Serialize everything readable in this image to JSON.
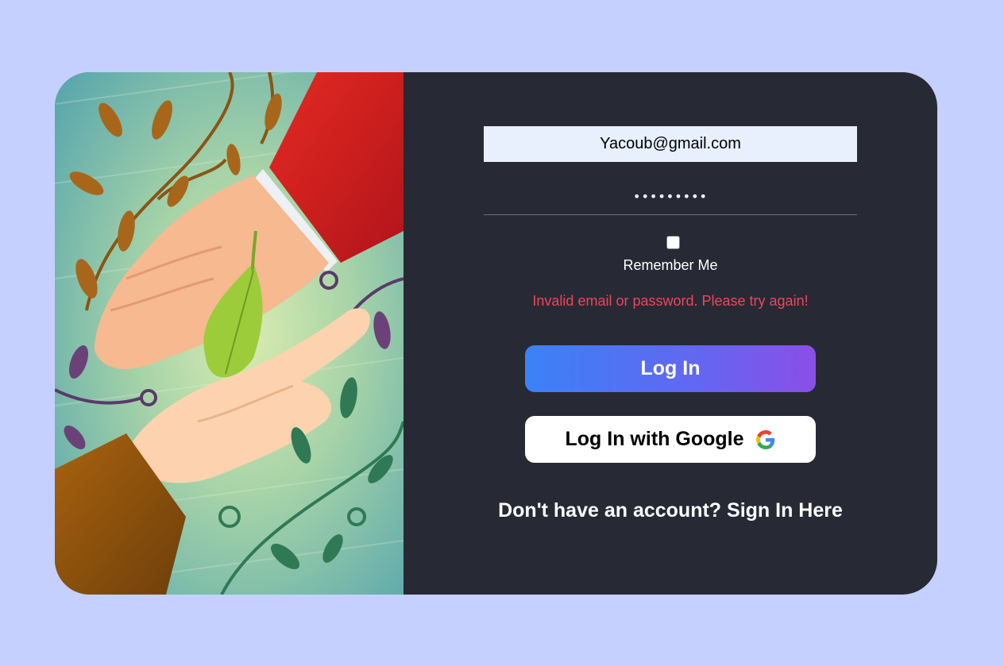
{
  "login": {
    "email_value": "Yacoub@gmail.com",
    "password_value": "•••••••••",
    "remember_label": "Remember Me",
    "remember_checked": false,
    "error_message": "Invalid email or password. Please try again!",
    "login_button": "Log In",
    "google_button": "Log In with Google",
    "signup_prompt": "Don't have an account?",
    "signup_link": "Sign In Here"
  },
  "colors": {
    "page_background": "#c5d0fe",
    "card_background": "#272a34",
    "error_text": "#f0445c",
    "login_gradient_start": "#3b82f6",
    "login_gradient_end": "#8b4ee8"
  },
  "illustration": {
    "icons": [
      "hands-icon",
      "leaf-icon",
      "vine-icon"
    ]
  }
}
